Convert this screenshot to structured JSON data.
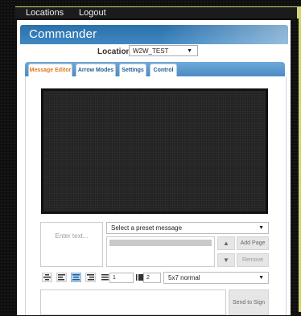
{
  "nav": {
    "locations": "Locations",
    "logout": "Logout"
  },
  "header": {
    "title": "Commander"
  },
  "location": {
    "label": "Location",
    "value": "W2W_TEST"
  },
  "tabs": [
    {
      "label": "Message Editor"
    },
    {
      "label": "Arrow Modes"
    },
    {
      "label": "Settings"
    },
    {
      "label": "Control"
    }
  ],
  "editor": {
    "text_placeholder": "Enter text...",
    "preset_label": "Select a preset message",
    "add_page": "Add Page",
    "remove": "Remove",
    "line_spacing": "1",
    "char_spacing": "2",
    "font": "5x7 normal",
    "send": "Send to Sign"
  },
  "icons": {
    "move_up": "triangle-up-icon",
    "move_down": "triangle-down-icon",
    "align_center": "align-center-icon",
    "align_left": "align-left-icon",
    "align_middle": "align-middle-icon",
    "align_right": "align-right-icon"
  },
  "colors": {
    "header": "#3479b5",
    "active_tab": "#e0771d",
    "accent_yellow": "#d4d36a"
  }
}
